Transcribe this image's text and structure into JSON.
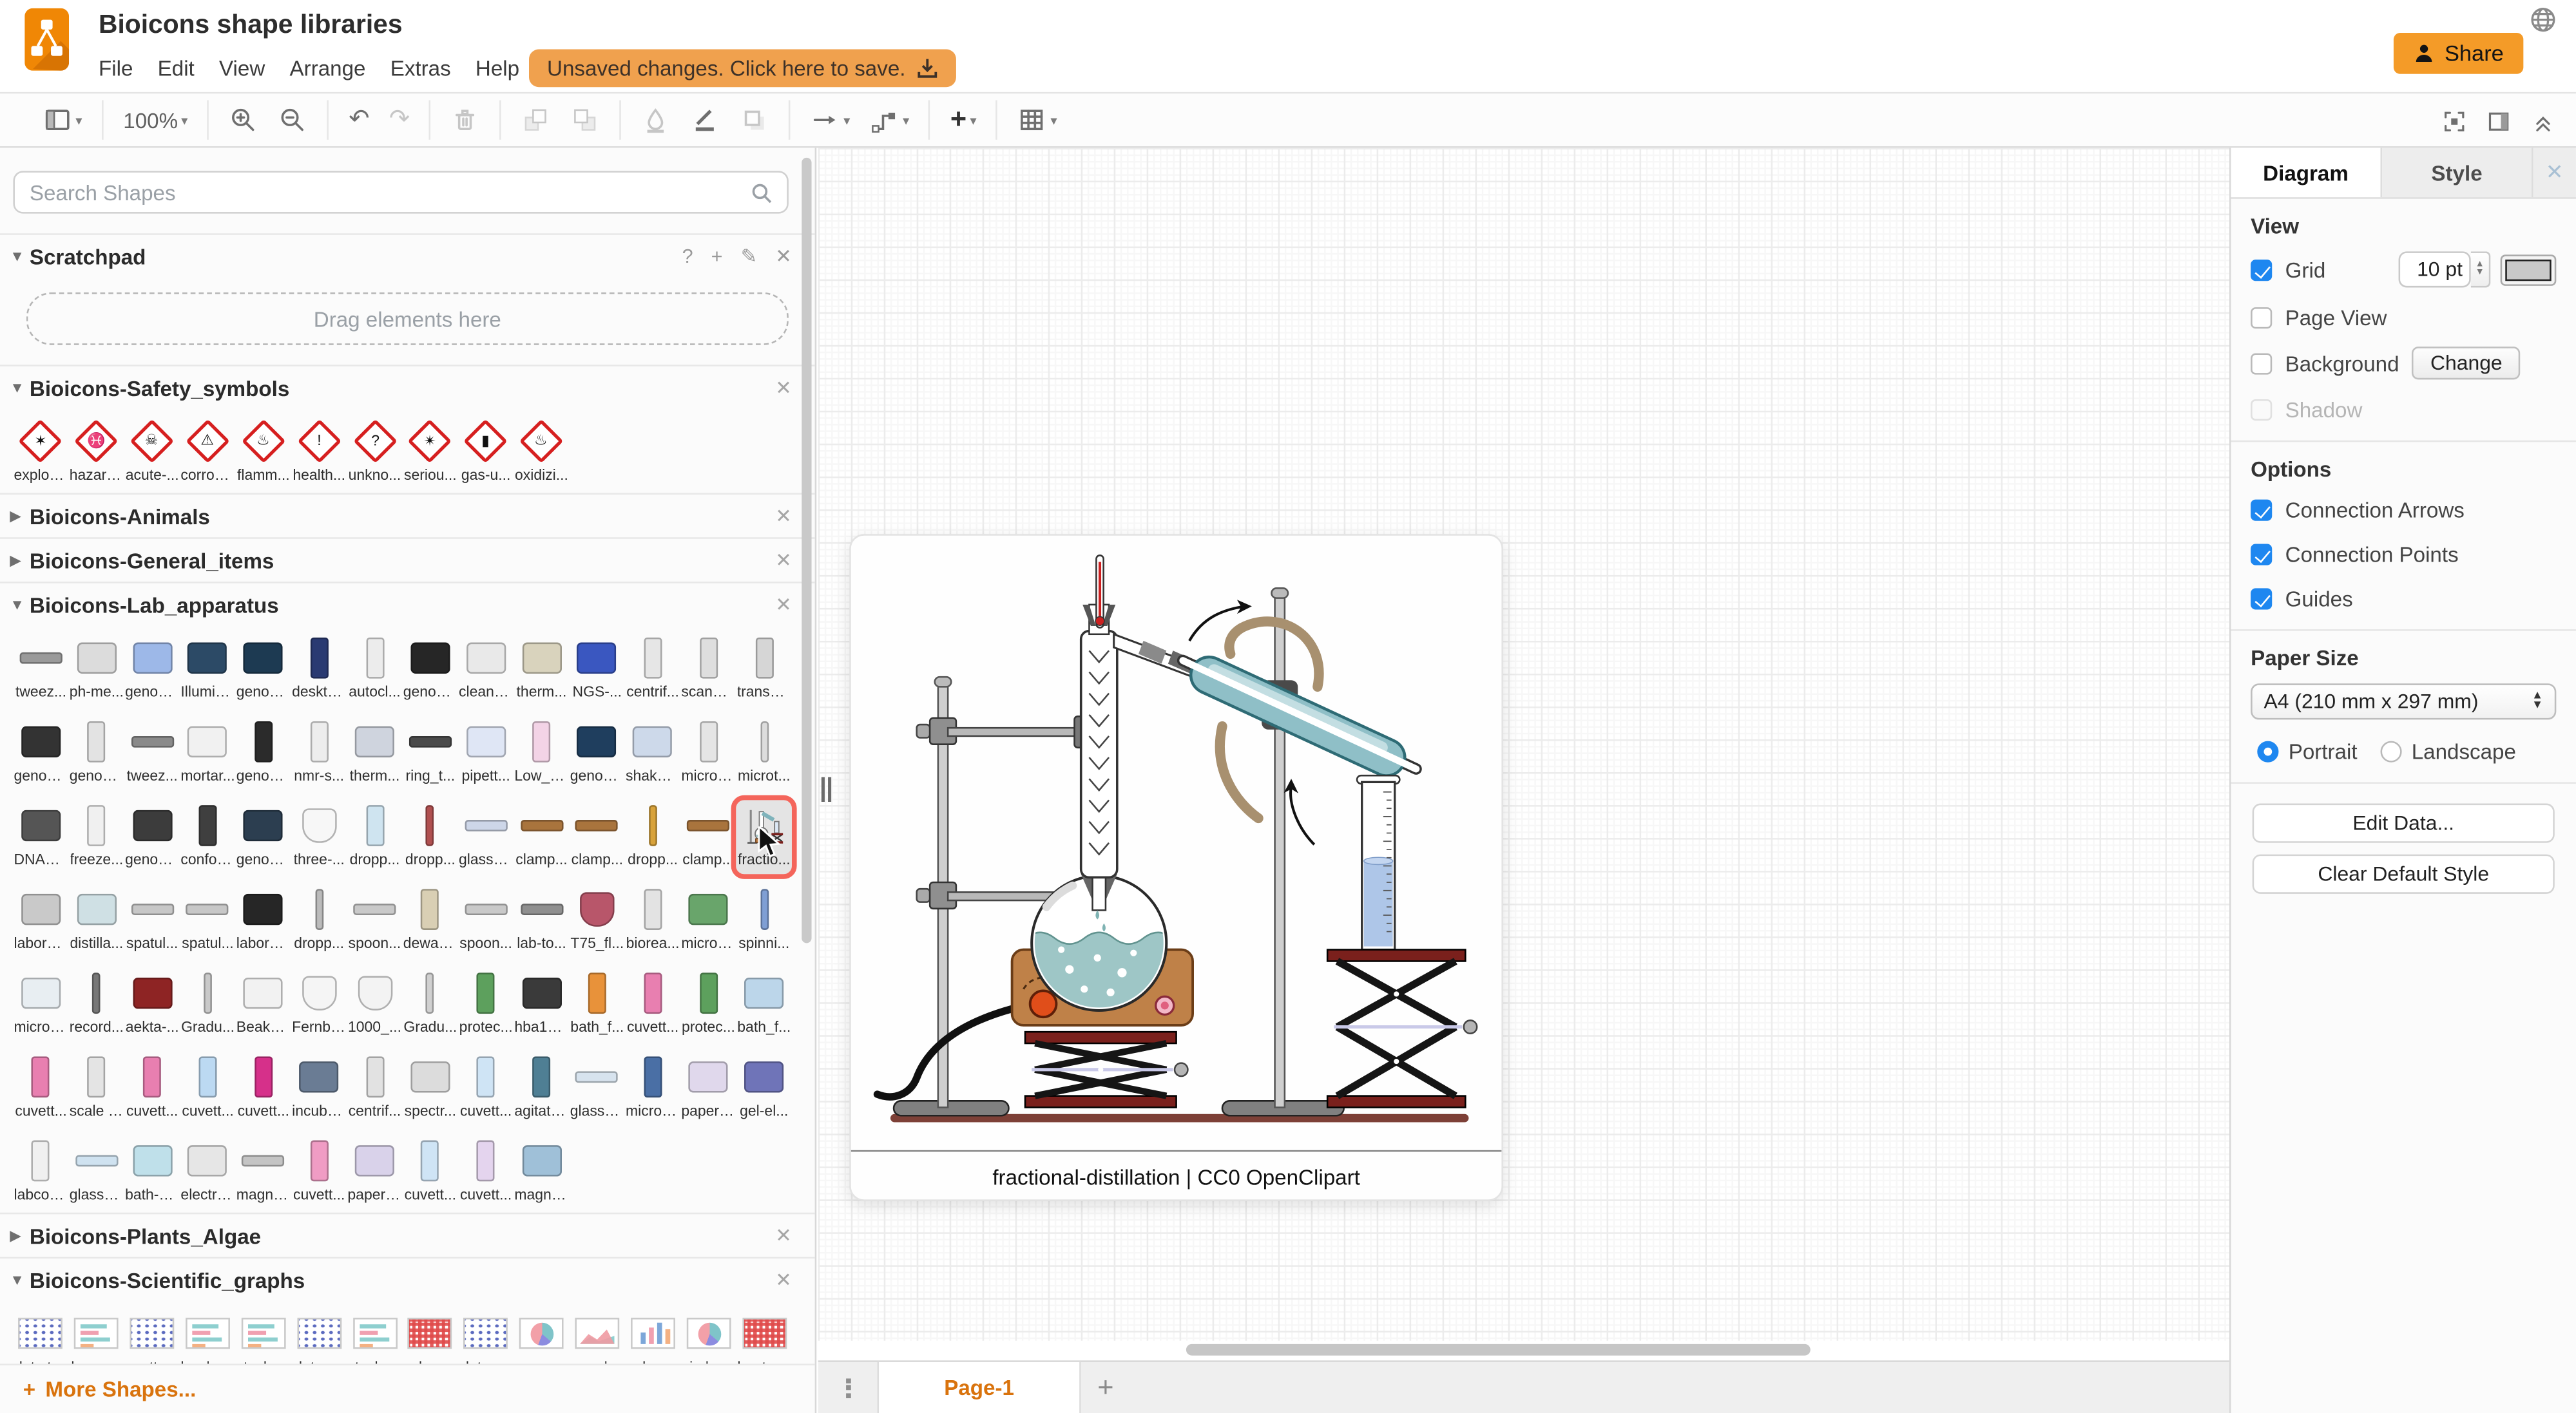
{
  "header": {
    "title": "Bioicons shape libraries",
    "menus": [
      "File",
      "Edit",
      "View",
      "Arrange",
      "Extras",
      "Help"
    ],
    "unsaved_label": "Unsaved changes. Click here to save.",
    "share_label": "Share"
  },
  "toolbar": {
    "zoom": "100%",
    "groups": [
      [
        {
          "name": "view-toggle",
          "icon": "panel",
          "caret": true
        }
      ],
      [
        {
          "name": "zoom-level",
          "text": true,
          "caret": true
        }
      ],
      [
        {
          "name": "zoom-in",
          "icon": "zoomin"
        },
        {
          "name": "zoom-out",
          "icon": "zoomout"
        }
      ],
      [
        {
          "name": "undo",
          "glyph": "↶"
        },
        {
          "name": "redo",
          "glyph": "↷",
          "off": true
        }
      ],
      [
        {
          "name": "delete",
          "icon": "trash",
          "off": true
        }
      ],
      [
        {
          "name": "to-front",
          "icon": "tofront",
          "off": true
        },
        {
          "name": "to-back",
          "icon": "toback",
          "off": true
        }
      ],
      [
        {
          "name": "fill-color",
          "icon": "fill",
          "off": true
        },
        {
          "name": "line-color",
          "icon": "line"
        },
        {
          "name": "shadow",
          "icon": "shadow",
          "off": true
        }
      ],
      [
        {
          "name": "connection",
          "icon": "conn",
          "caret": true
        },
        {
          "name": "waypoints",
          "icon": "waypoint",
          "caret": true
        }
      ],
      [
        {
          "name": "insert",
          "glyph": "+",
          "bold": true,
          "caret": true
        }
      ],
      [
        {
          "name": "table",
          "icon": "table",
          "caret": true
        }
      ]
    ],
    "right": [
      "fullscreen",
      "format-panel",
      "collapse"
    ]
  },
  "sidebar": {
    "search_placeholder": "Search Shapes",
    "scratchpad": {
      "title": "Scratchpad",
      "drag_hint": "Drag elements here"
    },
    "more_shapes": "More Shapes...",
    "sections": [
      {
        "label": "Bioicons-Safety_symbols",
        "expanded": true,
        "kind": "safety",
        "items": [
          {
            "label": "explos...",
            "glyph": "✶"
          },
          {
            "label": "hazard...",
            "glyph": "♓"
          },
          {
            "label": "acute-...",
            "glyph": "☠"
          },
          {
            "label": "corrosi...",
            "glyph": "⚠"
          },
          {
            "label": "flamm...",
            "glyph": "♨"
          },
          {
            "label": "health...",
            "glyph": "!"
          },
          {
            "label": "unkno...",
            "glyph": "?"
          },
          {
            "label": "seriou...",
            "glyph": "✴"
          },
          {
            "label": "gas-u...",
            "glyph": "▮"
          },
          {
            "label": "oxidizi...",
            "glyph": "♨"
          }
        ]
      },
      {
        "label": "Bioicons-Animals",
        "expanded": false
      },
      {
        "label": "Bioicons-General_items",
        "expanded": false
      },
      {
        "label": "Bioicons-Lab_apparatus",
        "expanded": true,
        "kind": "shapes",
        "rows": [
          [
            {
              "l": "tweez...",
              "k": "wide",
              "c": "#9a9a9a"
            },
            {
              "l": "ph-me...",
              "k": "box",
              "c": "#dcdcdc"
            },
            {
              "l": "genom...",
              "k": "box",
              "c": "#9db8e8"
            },
            {
              "l": "Illumin...",
              "k": "box",
              "c": "#2c4a66"
            },
            {
              "l": "genom...",
              "k": "box",
              "c": "#1d3a52"
            },
            {
              "l": "deskto...",
              "k": "tall",
              "c": "#2a3a72"
            },
            {
              "l": "autocl...",
              "k": "tall",
              "c": "#ececec"
            },
            {
              "l": "genom...",
              "k": "box",
              "c": "#262626"
            },
            {
              "l": "cleanb...",
              "k": "box",
              "c": "#e9e9e9"
            },
            {
              "l": "therm...",
              "k": "box",
              "c": "#d9d3bd"
            },
            {
              "l": "NGS-...",
              "k": "box",
              "c": "#3a57c0"
            },
            {
              "l": "centrif...",
              "k": "tall",
              "c": "#e6e6e6"
            },
            {
              "l": "scanni...",
              "k": "tall",
              "c": "#dedede"
            },
            {
              "l": "transm...",
              "k": "tall",
              "c": "#d6d6d6"
            }
          ],
          [
            {
              "l": "genom...",
              "k": "box",
              "c": "#333333"
            },
            {
              "l": "genom...",
              "k": "tall",
              "c": "#e3e3e3"
            },
            {
              "l": "tweez...",
              "k": "wide",
              "c": "#8a8a8a"
            },
            {
              "l": "mortar...",
              "k": "box",
              "c": "#f1f1f1"
            },
            {
              "l": "genom...",
              "k": "tall",
              "c": "#2b2b2b"
            },
            {
              "l": "nmr-s...",
              "k": "tall",
              "c": "#ededed"
            },
            {
              "l": "therm...",
              "k": "box",
              "c": "#cfd4de"
            },
            {
              "l": "ring_t...",
              "k": "wide",
              "c": "#4a4a4a"
            },
            {
              "l": "pipett...",
              "k": "box",
              "c": "#dfe6f5"
            },
            {
              "l": "Low_s...",
              "k": "tall",
              "c": "#f3d3e6"
            },
            {
              "l": "genom...",
              "k": "box",
              "c": "#1f3e5e"
            },
            {
              "l": "shaker...",
              "k": "box",
              "c": "#cdd9ea"
            },
            {
              "l": "micros...",
              "k": "tall",
              "c": "#e5e5e5"
            },
            {
              "l": "microt...",
              "k": "tube",
              "c": "#dddddd"
            }
          ],
          [
            {
              "l": "DNA_s...",
              "k": "box",
              "c": "#555555"
            },
            {
              "l": "freeze...",
              "k": "tall",
              "c": "#f0f0f0"
            },
            {
              "l": "genom...",
              "k": "box",
              "c": "#3c3c3c"
            },
            {
              "l": "confoc...",
              "k": "tall",
              "c": "#3f3f3f"
            },
            {
              "l": "genom...",
              "k": "box",
              "c": "#2c3e50"
            },
            {
              "l": "three-...",
              "k": "flask",
              "c": "#f7f7f7"
            },
            {
              "l": "dropp...",
              "k": "tall",
              "c": "#cfe4f0"
            },
            {
              "l": "dropp...",
              "k": "tube",
              "c": "#b05050"
            },
            {
              "l": "glass-r...",
              "k": "wide",
              "c": "#cdd6e8"
            },
            {
              "l": "clamp...",
              "k": "wide",
              "c": "#a9743d"
            },
            {
              "l": "clamp...",
              "k": "wide",
              "c": "#a9743d"
            },
            {
              "l": "dropp...",
              "k": "tube",
              "c": "#d8a23a"
            },
            {
              "l": "clamp...",
              "k": "wide",
              "c": "#a9743d"
            },
            {
              "l": "fractio...",
              "k": "box",
              "c": "#9bb5bb",
              "sel": true
            }
          ],
          [
            {
              "l": "laborat...",
              "k": "box",
              "c": "#c9c9c9"
            },
            {
              "l": "distilla...",
              "k": "box",
              "c": "#cfe0e4"
            },
            {
              "l": "spatul...",
              "k": "wide",
              "c": "#c7c7c7"
            },
            {
              "l": "spatul...",
              "k": "wide",
              "c": "#c7c7c7"
            },
            {
              "l": "laborat...",
              "k": "box",
              "c": "#262626"
            },
            {
              "l": "dropp...",
              "k": "tube",
              "c": "#bbbbbb"
            },
            {
              "l": "spoon...",
              "k": "wide",
              "c": "#c9c9c9"
            },
            {
              "l": "dewar-...",
              "k": "tall",
              "c": "#d9cfb4"
            },
            {
              "l": "spoon...",
              "k": "wide",
              "c": "#c9c9c9"
            },
            {
              "l": "lab-to...",
              "k": "wide",
              "c": "#8f8f8f"
            },
            {
              "l": "T75_fl...",
              "k": "flask",
              "c": "#b8566a"
            },
            {
              "l": "biorea...",
              "k": "tall",
              "c": "#e3e3e3"
            },
            {
              "l": "micro_...",
              "k": "box",
              "c": "#69a56b"
            },
            {
              "l": "spinni...",
              "k": "tube",
              "c": "#7f9fd4"
            }
          ],
          [
            {
              "l": "microfl...",
              "k": "box",
              "c": "#e8eef2"
            },
            {
              "l": "record...",
              "k": "tube",
              "c": "#777777"
            },
            {
              "l": "aekta-...",
              "k": "box",
              "c": "#8e2424"
            },
            {
              "l": "Gradu...",
              "k": "tube",
              "c": "#c9c9c9"
            },
            {
              "l": "Beaker...",
              "k": "box",
              "c": "#f2f2f2"
            },
            {
              "l": "Fernba...",
              "k": "flask",
              "c": "#f5f5f5"
            },
            {
              "l": "1000_...",
              "k": "flask",
              "c": "#f3f3f3"
            },
            {
              "l": "Gradu...",
              "k": "tube",
              "c": "#d0d0d0"
            },
            {
              "l": "protec...",
              "k": "tall",
              "c": "#5da05d"
            },
            {
              "l": "hba1ca...",
              "k": "box",
              "c": "#3a3a3a"
            },
            {
              "l": "bath_f...",
              "k": "tall",
              "c": "#e8923a"
            },
            {
              "l": "cuvett...",
              "k": "tall",
              "c": "#e87fb0"
            },
            {
              "l": "protec...",
              "k": "tall",
              "c": "#5da05d"
            },
            {
              "l": "bath_f...",
              "k": "box",
              "c": "#bcd6ea"
            }
          ],
          [
            {
              "l": "cuvett...",
              "k": "tall",
              "c": "#e87fb0"
            },
            {
              "l": "scale | ...",
              "k": "tall",
              "c": "#e4e4e4"
            },
            {
              "l": "cuvett...",
              "k": "tall",
              "c": "#e87fb0"
            },
            {
              "l": "cuvett...",
              "k": "tall",
              "c": "#bcd9f2"
            },
            {
              "l": "cuvett...",
              "k": "tall",
              "c": "#d6308a"
            },
            {
              "l": "incuba...",
              "k": "box",
              "c": "#6a7c94"
            },
            {
              "l": "centrif...",
              "k": "tall",
              "c": "#e2e2e2"
            },
            {
              "l": "spectr...",
              "k": "box",
              "c": "#dcdcdc"
            },
            {
              "l": "cuvett...",
              "k": "tall",
              "c": "#cfe4f5"
            },
            {
              "l": "agitato...",
              "k": "tall",
              "c": "#4f7f94"
            },
            {
              "l": "glasssl...",
              "k": "wide",
              "c": "#d7e3ee"
            },
            {
              "l": "micros...",
              "k": "tall",
              "c": "#4a6fa5"
            },
            {
              "l": "paper-...",
              "k": "box",
              "c": "#e0d8ec"
            },
            {
              "l": "gel-el...",
              "k": "box",
              "c": "#6f74b8"
            }
          ],
          [
            {
              "l": "labcoa...",
              "k": "tall",
              "c": "#f0f0f0"
            },
            {
              "l": "glasssl...",
              "k": "wide",
              "c": "#cfe2f0"
            },
            {
              "l": "bath-e...",
              "k": "box",
              "c": "#bfe0ea"
            },
            {
              "l": "electro...",
              "k": "box",
              "c": "#e6e6e6"
            },
            {
              "l": "magne...",
              "k": "wide",
              "c": "#c4c4c4"
            },
            {
              "l": "cuvett...",
              "k": "tall",
              "c": "#f09cc4"
            },
            {
              "l": "paper-...",
              "k": "box",
              "c": "#d9d2ea"
            },
            {
              "l": "cuvett...",
              "k": "tall",
              "c": "#cfe4f5"
            },
            {
              "l": "cuvett...",
              "k": "tall",
              "c": "#e4d4ee"
            },
            {
              "l": "magne...",
              "k": "box",
              "c": "#9fc0d8"
            }
          ]
        ]
      },
      {
        "label": "Bioicons-Plants_Algae",
        "expanded": false
      },
      {
        "label": "Bioicons-Scientific_graphs",
        "expanded": true,
        "kind": "graphs",
        "items": [
          {
            "label": "dot-str...",
            "chart": "scatter"
          },
          {
            "label": "bar-gr...",
            "chart": "bars"
          },
          {
            "label": "scatte...",
            "chart": "scatter"
          },
          {
            "label": "bar | M...",
            "chart": "bars"
          },
          {
            "label": "stacke...",
            "chart": "bars"
          },
          {
            "label": "dot-m...",
            "chart": "scatter"
          },
          {
            "label": "stacke...",
            "chart": "bars"
          },
          {
            "label": "calend...",
            "chart": "heat"
          },
          {
            "label": "dot-m...",
            "chart": "scatter"
          },
          {
            "label": "coxco...",
            "chart": "pie"
          },
          {
            "label": "area | ...",
            "chart": "area"
          },
          {
            "label": "colum...",
            "chart": "cols"
          },
          {
            "label": "pie | M...",
            "chart": "pie"
          },
          {
            "label": "heatm...",
            "chart": "heat"
          }
        ]
      }
    ]
  },
  "canvas": {
    "preview_caption": "fractional-distillation | CC0 OpenClipart",
    "page_tab": "Page-1"
  },
  "rightpanel": {
    "tabs": [
      "Diagram",
      "Style"
    ],
    "view": {
      "title": "View",
      "grid": "Grid",
      "grid_size": "10 pt",
      "grid_color": "#c9c9c9",
      "page_view": "Page View",
      "background": "Background",
      "change": "Change",
      "shadow": "Shadow"
    },
    "options": {
      "title": "Options",
      "items": [
        "Connection Arrows",
        "Connection Points",
        "Guides"
      ]
    },
    "paper": {
      "title": "Paper Size",
      "value": "A4 (210 mm x 297 mm)",
      "portrait": "Portrait",
      "landscape": "Landscape"
    },
    "edit_data": "Edit Data...",
    "clear_style": "Clear Default Style"
  },
  "accent_colors": {
    "brand_orange": "#f08705",
    "action_orange": "#f49b28",
    "warning_orange": "#f0a14e",
    "link_orange": "#d9730d",
    "selection_red": "#f4655b",
    "check_blue": "#1e87f0"
  }
}
